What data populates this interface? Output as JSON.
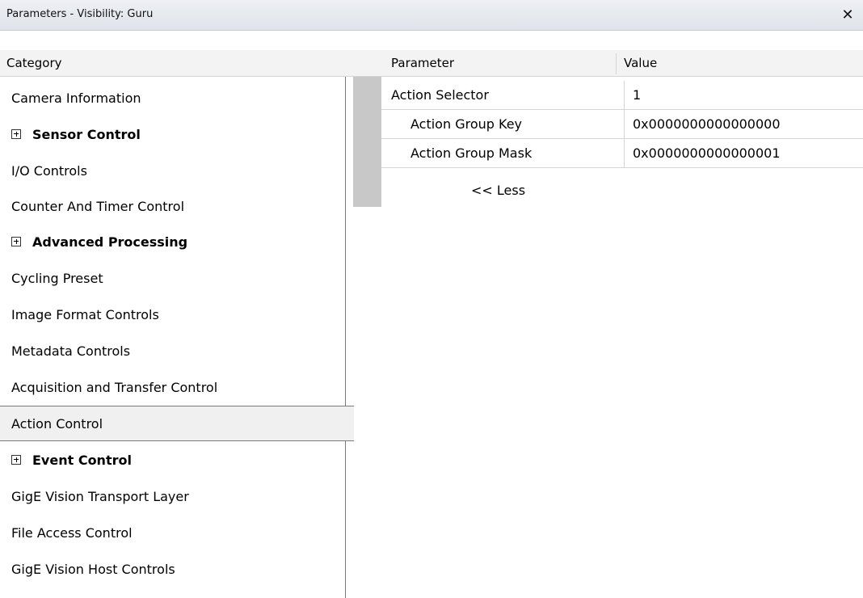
{
  "window": {
    "title": "Parameters - Visibility: Guru",
    "close_symbol": "✕"
  },
  "headers": {
    "category": "Category",
    "parameter": "Parameter",
    "value": "Value"
  },
  "categories": [
    {
      "label": "Camera Information",
      "expandable": false
    },
    {
      "label": "Sensor Control",
      "expandable": true
    },
    {
      "label": "I/O Controls",
      "expandable": false
    },
    {
      "label": "Counter And Timer Control",
      "expandable": false
    },
    {
      "label": "Advanced Processing",
      "expandable": true
    },
    {
      "label": "Cycling Preset",
      "expandable": false
    },
    {
      "label": "Image Format Controls",
      "expandable": false
    },
    {
      "label": "Metadata Controls",
      "expandable": false
    },
    {
      "label": "Acquisition and Transfer Control",
      "expandable": false
    },
    {
      "label": "Action Control",
      "expandable": false,
      "selected": true
    },
    {
      "label": "Event Control",
      "expandable": true
    },
    {
      "label": "GigE Vision Transport Layer",
      "expandable": false
    },
    {
      "label": "File Access Control",
      "expandable": false
    },
    {
      "label": "GigE Vision Host Controls",
      "expandable": false
    }
  ],
  "parameters": [
    {
      "name": "Action Selector",
      "value": "1"
    },
    {
      "name": "Action Group Key",
      "value": "0x0000000000000000"
    },
    {
      "name": "Action Group Mask",
      "value": "0x0000000000000001"
    }
  ],
  "less_link": "<< Less",
  "icons": {
    "expand": "plus-box-icon",
    "close": "close-icon"
  }
}
